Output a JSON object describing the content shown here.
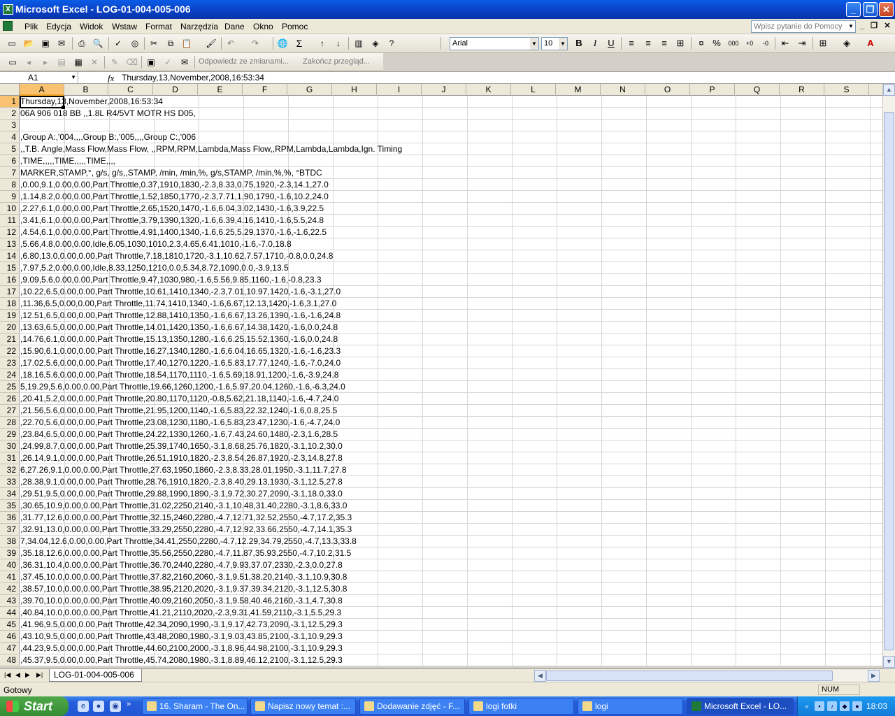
{
  "window": {
    "title": "Microsoft Excel - LOG-01-004-005-006"
  },
  "menu": {
    "items": [
      "Plik",
      "Edycja",
      "Widok",
      "Wstaw",
      "Format",
      "Narzędzia",
      "Dane",
      "Okno",
      "Pomoc"
    ],
    "help_placeholder": "Wpisz pytanie do Pomocy"
  },
  "toolbar": {
    "font": "Arial",
    "size": "10",
    "bold": "B",
    "italic": "I",
    "underline": "U",
    "sum": "Σ",
    "percent": "%",
    "review_reply": "Odpowiedz ze zmianami...",
    "review_end": "Zakończ przegląd..."
  },
  "formula": {
    "cell": "A1",
    "fx": "fx",
    "value": "Thursday,13,November,2008,16:53:34"
  },
  "columns": [
    "A",
    "B",
    "C",
    "D",
    "E",
    "F",
    "G",
    "H",
    "I",
    "J",
    "K",
    "L",
    "M",
    "N",
    "O",
    "P",
    "Q",
    "R",
    "S"
  ],
  "rows": [
    {
      "n": "1",
      "a": "Thursday,13,November,2008,16:53:34"
    },
    {
      "n": "2",
      "a": "06A 906 018 BB ,,1.8L R4/5VT MOTR HS D05,"
    },
    {
      "n": "3",
      "a": ""
    },
    {
      "n": "4",
      "a": ",Group A:,'004,,,,Group B:,'005,,,,Group C:,'006"
    },
    {
      "n": "5",
      "a": ",,T.B. Angle,Mass Flow,Mass Flow, ,,RPM,RPM,Lambda,Mass Flow,,RPM,Lambda,Lambda,Ign. Timing"
    },
    {
      "n": "6",
      "a": ",TIME,,,,,TIME,,,,,TIME,,,,"
    },
    {
      "n": "7",
      "a": "MARKER,STAMP,°, g/s, g/s,,STAMP, /min, /min,%, g/s,STAMP, /min,%,%, °BTDC"
    },
    {
      "n": "8",
      "a": ",0.00,9.1,0.00,0.00,Part Throttle,0.37,1910,1830,-2.3,8.33,0.75,1920,-2.3,14.1,27.0"
    },
    {
      "n": "9",
      "a": ",1.14,8.2,0.00,0.00,Part Throttle,1.52,1850,1770,-2.3,7.71,1.90,1790,-1.6,10.2,24.0"
    },
    {
      "n": "10",
      "a": ",2.27,6.1,0.00,0.00,Part Throttle,2.65,1520,1470,-1.6,6.04,3.02,1430,-1.6,3.9,22.5"
    },
    {
      "n": "11",
      "a": ",3.41,6.1,0.00,0.00,Part Throttle,3.79,1390,1320,-1.6,6.39,4.16,1410,-1.6,5.5,24.8"
    },
    {
      "n": "12",
      "a": ",4.54,6.1,0.00,0.00,Part Throttle,4.91,1400,1340,-1.6,6.25,5.29,1370,-1.6,-1.6,22.5"
    },
    {
      "n": "13",
      "a": ",5.66,4.8,0.00,0.00,Idle,6.05,1030,1010,2.3,4.65,6.41,1010,-1.6,-7.0,18.8"
    },
    {
      "n": "14",
      "a": ",6.80,13.0,0.00,0.00,Part Throttle,7.18,1810,1720,-3.1,10.62,7.57,1710,-0.8,0.0,24.8"
    },
    {
      "n": "15",
      "a": ",7.97,5.2,0.00,0.00,Idle,8.33,1250,1210,0.0,5.34,8.72,1090,0.0,-3.9,13.5"
    },
    {
      "n": "16",
      "a": ",9.09,5.6,0.00,0.00,Part Throttle,9.47,1030,980,-1.6,5.56,9.85,1160,-1.6,-0.8,23.3"
    },
    {
      "n": "17",
      "a": ",10.22,6.5,0.00,0.00,Part Throttle,10.61,1410,1340,-2.3,7.01,10.97,1420,-1.6,-3.1,27.0"
    },
    {
      "n": "18",
      "a": ",11.36,6.5,0.00,0.00,Part Throttle,11.74,1410,1340,-1.6,6.67,12.13,1420,-1.6,3.1,27.0"
    },
    {
      "n": "19",
      "a": ",12.51,6.5,0.00,0.00,Part Throttle,12.88,1410,1350,-1.6,6.67,13.26,1390,-1.6,-1.6,24.8"
    },
    {
      "n": "20",
      "a": ",13.63,6.5,0.00,0.00,Part Throttle,14.01,1420,1350,-1.6,6.67,14.38,1420,-1.6,0.0,24.8"
    },
    {
      "n": "21",
      "a": ",14.76,6.1,0.00,0.00,Part Throttle,15.13,1350,1280,-1.6,6.25,15.52,1360,-1.6,0.0,24.8"
    },
    {
      "n": "22",
      "a": ",15.90,6.1,0.00,0.00,Part Throttle,16.27,1340,1280,-1.6,6.04,16.65,1320,-1.6,-1.6,23.3"
    },
    {
      "n": "23",
      "a": ",17.02,5.6,0.00,0.00,Part Throttle,17.40,1270,1220,-1.6,5.83,17.77,1240,-1.6,-7.0,24.0"
    },
    {
      "n": "24",
      "a": ",18.16,5.6,0.00,0.00,Part Throttle,18.54,1170,1110,-1.6,5.69,18.91,1200,-1.6,-3.9,24.8"
    },
    {
      "n": "25",
      "a": "5,19.29,5.6,0.00,0.00,Part Throttle,19.66,1260,1200,-1.6,5.97,20.04,1260,-1.6,-6.3,24.0"
    },
    {
      "n": "26",
      "a": ",20.41,5.2,0.00,0.00,Part Throttle,20.80,1170,1120,-0.8,5.62,21.18,1140,-1.6,-4.7,24.0"
    },
    {
      "n": "27",
      "a": ",21.56,5.6,0.00,0.00,Part Throttle,21.95,1200,1140,-1.6,5.83,22.32,1240,-1.6,0.8,25.5"
    },
    {
      "n": "28",
      "a": ",22.70,5.6,0.00,0.00,Part Throttle,23.08,1230,1180,-1.6,5.83,23.47,1230,-1.6,-4.7,24.0"
    },
    {
      "n": "29",
      "a": ",23.84,6.5,0.00,0.00,Part Throttle,24.22,1330,1260,-1.6,7.43,24.60,1480,-2.3,1.6,28.5"
    },
    {
      "n": "30",
      "a": ",24.99,8.7,0.00,0.00,Part Throttle,25.39,1740,1650,-3.1,8.68,25.76,1820,-3.1,10.2,30.0"
    },
    {
      "n": "31",
      "a": ",26.14,9.1,0.00,0.00,Part Throttle,26.51,1910,1820,-2.3,8.54,26.87,1920,-2.3,14.8,27.8"
    },
    {
      "n": "32",
      "a": "6,27.26,9.1,0.00,0.00,Part Throttle,27.63,1950,1860,-2.3,8.33,28.01,1950,-3.1,11.7,27.8"
    },
    {
      "n": "33",
      "a": ",28.38,9.1,0.00,0.00,Part Throttle,28.76,1910,1820,-2.3,8.40,29.13,1930,-3.1,12.5,27.8"
    },
    {
      "n": "34",
      "a": ",29.51,9.5,0.00,0.00,Part Throttle,29.88,1990,1890,-3.1,9.72,30.27,2090,-3.1,18.0,33.0"
    },
    {
      "n": "35",
      "a": ",30.65,10.9,0.00,0.00,Part Throttle,31.02,2250,2140,-3.1,10.48,31.40,2280,-3.1,8.6,33.0"
    },
    {
      "n": "36",
      "a": ",31.77,12.6,0.00,0.00,Part Throttle,32.15,2460,2280,-4.7,12.71,32.52,2550,-4.7,17.2,35.3"
    },
    {
      "n": "37",
      "a": ",32.91,13.0,0.00,0.00,Part Throttle,33.29,2550,2280,-4.7,12.92,33.66,2550,-4.7,14.1,35.3"
    },
    {
      "n": "38",
      "a": "7,34.04,12.6,0.00,0.00,Part Throttle,34.41,2550,2280,-4.7,12.29,34.79,2550,-4.7,13.3,33.8"
    },
    {
      "n": "39",
      "a": ",35.18,12.6,0.00,0.00,Part Throttle,35.56,2550,2280,-4.7,11.87,35.93,2550,-4.7,10.2,31.5"
    },
    {
      "n": "40",
      "a": ",36.31,10.4,0.00,0.00,Part Throttle,36.70,2440,2280,-4.7,9.93,37.07,2330,-2.3,0.0,27.8"
    },
    {
      "n": "41",
      "a": ",37.45,10.0,0.00,0.00,Part Throttle,37.82,2160,2060,-3.1,9.51,38.20,2140,-3.1,10.9,30.8"
    },
    {
      "n": "42",
      "a": ",38.57,10.0,0.00,0.00,Part Throttle,38.95,2120,2020,-3.1,9.37,39.34,2120,-3.1,12.5,30.8"
    },
    {
      "n": "43",
      "a": ",39.70,10.0,0.00,0.00,Part Throttle,40.09,2160,2050,-3.1,9.58,40.46,2160,-3.1,4.7,30.8"
    },
    {
      "n": "44",
      "a": ",40.84,10.0,0.00,0.00,Part Throttle,41.21,2110,2020,-2.3,9.31,41.59,2110,-3.1,5.5,29.3"
    },
    {
      "n": "45",
      "a": ",41.96,9.5,0.00,0.00,Part Throttle,42.34,2090,1990,-3.1,9.17,42.73,2090,-3.1,12.5,29.3"
    },
    {
      "n": "46",
      "a": ",43.10,9.5,0.00,0.00,Part Throttle,43.48,2080,1980,-3.1,9.03,43.85,2100,-3.1,10.9,29.3"
    },
    {
      "n": "47",
      "a": ",44.23,9.5,0.00,0.00,Part Throttle,44.60,2100,2000,-3.1,8.96,44.98,2100,-3.1,10.9,29.3"
    },
    {
      "n": "48",
      "a": ",45.37,9.5,0.00,0.00,Part Throttle,45.74,2080,1980,-3.1,8.89,46.12,2100,-3.1,12.5,29.3"
    }
  ],
  "sheet": {
    "tab": "LOG-01-004-005-006"
  },
  "status": {
    "text": "Gotowy",
    "num": "NUM"
  },
  "taskbar": {
    "start": "Start",
    "tasks": [
      "16. Sharam - The On...",
      "Napisz nowy temat :...",
      "Dodawanie zdjęć - F...",
      "logi fotki",
      "logi",
      "Microsoft Excel - LO..."
    ],
    "clock": "18:03"
  }
}
